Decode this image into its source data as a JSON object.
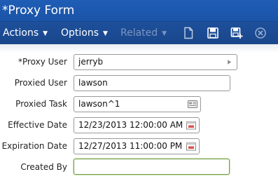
{
  "window": {
    "title": "*Proxy Form"
  },
  "toolbar": {
    "actions_label": "Actions",
    "options_label": "Options",
    "related_label": "Related",
    "icons": [
      "new-document-icon",
      "save-icon",
      "save-and-new-icon",
      "delete-icon"
    ]
  },
  "form": {
    "proxy_user": {
      "label": "*Proxy User",
      "value": "jerryb"
    },
    "proxied_user": {
      "label": "Proxied User",
      "value": "lawson"
    },
    "proxied_task": {
      "label": "Proxied Task",
      "value": "lawson^1"
    },
    "effective_date": {
      "label": "Effective Date",
      "value": "12/23/2013 12:00:00 AM"
    },
    "expiration_date": {
      "label": "Expiration Date",
      "value": "12/27/2013 11:00:00 PM"
    },
    "created_by": {
      "label": "Created By",
      "value": ""
    }
  },
  "colors": {
    "title_bar": "#1f5db6",
    "toolbar": "#1d4f9b",
    "disabled_menu": "#7b95bf",
    "focus_border": "#6f9a43"
  }
}
